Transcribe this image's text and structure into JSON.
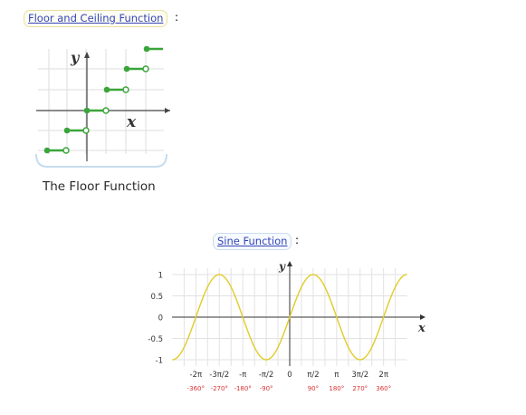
{
  "floor_link": {
    "label": "Floor and Ceiling Function",
    "colon": ":"
  },
  "floor_caption": "The Floor Function",
  "floor_graph": {
    "x_label": "x",
    "y_label": "y"
  },
  "sine_link": {
    "label": "Sine Function",
    "colon": ":"
  },
  "chart_data": {
    "type": "line",
    "title": "",
    "xlabel": "x",
    "ylabel": "y",
    "function": "sin(x)",
    "x_range": [
      -7.85,
      7.85
    ],
    "ylim": [
      -1,
      1
    ],
    "y_ticks": [
      "1",
      "0.5",
      "0",
      "-0.5",
      "-1"
    ],
    "x_tick_labels": [
      "-2π",
      "-3π/2",
      "-π",
      "-π/2",
      "0",
      "π/2",
      "π",
      "3π/2",
      "2π"
    ],
    "x_degree_labels": [
      "-360°",
      "-270°",
      "-180°",
      "-90°",
      "",
      "90°",
      "180°",
      "270°",
      "360°"
    ],
    "series_color": "#e0cc29",
    "grid": true
  },
  "colors": {
    "link": "#3444b8",
    "step_green": "#3aa53a",
    "degree_red": "#dd3333"
  }
}
